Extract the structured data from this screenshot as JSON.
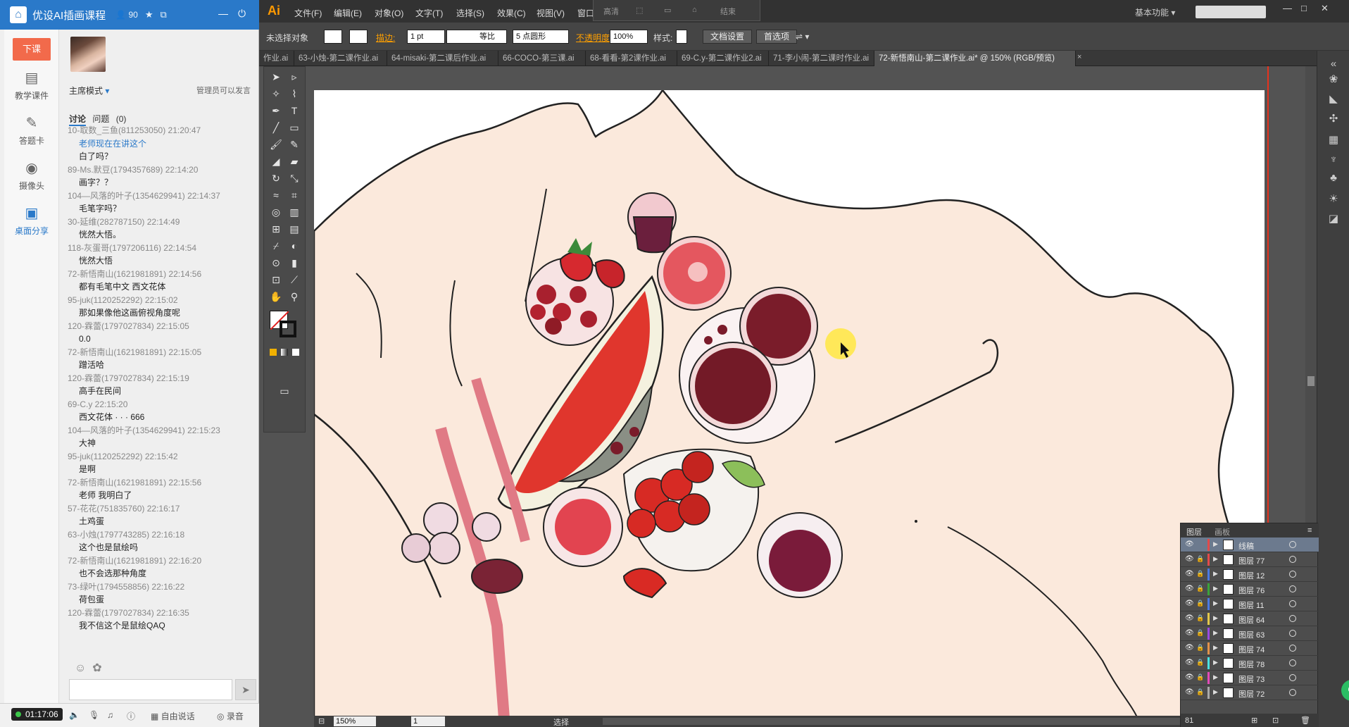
{
  "left_panel": {
    "title": "优设AI插画课程",
    "count": "90",
    "end_class": "下课",
    "nav": [
      "教学课件",
      "答题卡",
      "摄像头",
      "桌面分享"
    ],
    "mode": "主席模式",
    "admin_note": "管理员可以发言",
    "tab_discuss": "讨论",
    "tab_question": "问题",
    "question_count": "(0)",
    "messages": [
      {
        "u": "10-取数_三鱼(811253050) 21:20:47",
        "t": "老师现在在讲这个",
        "link": true
      },
      {
        "u": "",
        "t": "白了吗？"
      },
      {
        "u": "89-Ms.默豆(1794357689) 22:14:20",
        "t": "画字？？"
      },
      {
        "u": "104—风落的叶子(1354629941) 22:14:37",
        "t": "毛笔字吗？"
      },
      {
        "u": "30-延维(282787150) 22:14:49",
        "t": "恍然大悟。"
      },
      {
        "u": "118-灰蛋哥(1797206116) 22:14:54",
        "t": "恍然大悟"
      },
      {
        "u": "72-新悟南山(1621981891) 22:14:56",
        "t": "都有毛笔中文 西文花体"
      },
      {
        "u": "95-juk(1120252292) 22:15:02",
        "t": "那如果像他这画俯视角度呢"
      },
      {
        "u": "120-霖蕾(1797027834) 22:15:05",
        "t": "0.0"
      },
      {
        "u": "72-新悟南山(1621981891) 22:15:05",
        "t": "蹭活哈"
      },
      {
        "u": "120-霖蕾(1797027834) 22:15:19",
        "t": "高手在民间"
      },
      {
        "u": "69-C.y 22:15:20",
        "t": "西文花体 · · · 666"
      },
      {
        "u": "104—风落的叶子(1354629941) 22:15:23",
        "t": "大神"
      },
      {
        "u": "95-juk(1120252292) 22:15:42",
        "t": "是啊"
      },
      {
        "u": "72-新悟南山(1621981891) 22:15:56",
        "t": "老师  我明白了"
      },
      {
        "u": "57-花花(751835760) 22:16:17",
        "t": "土鸡蛋"
      },
      {
        "u": "63-小烛(1797743285) 22:16:18",
        "t": "这个也是鼠绘吗"
      },
      {
        "u": "72-新悟南山(1621981891) 22:16:20",
        "t": "也不会选那种角度"
      },
      {
        "u": "73-绿叶(1794558856) 22:16:22",
        "t": "荷包蛋"
      },
      {
        "u": "120-霖蕾(1797027834) 22:16:35",
        "t": "我不信这个是鼠绘QAQ"
      }
    ],
    "timer": "01:17:06",
    "free_speech": "自由说话",
    "record": "录音"
  },
  "ai": {
    "logo": "Ai",
    "menu": [
      "文件(F)",
      "编辑(E)",
      "对象(O)",
      "文字(T)",
      "选择(S)",
      "效果(C)",
      "视图(V)",
      "窗口"
    ],
    "record_bar": [
      "高清",
      "结束"
    ],
    "workspace": "基本功能",
    "control": {
      "no_selection": "未选择对象",
      "stroke_label": "描边:",
      "stroke_value": "1 pt",
      "profile": "等比",
      "brush": "5 点圆形",
      "opacity_label": "不透明度:",
      "opacity_value": "100%",
      "style_label": "样式:",
      "doc_setup": "文档设置",
      "prefs": "首选项"
    },
    "tabs": [
      "作业.ai",
      "63-小烛-第二课作业.ai",
      "64-misaki-第二课后作业.ai",
      "66-COCO-第三课.ai",
      "68-看看-第2课作业.ai",
      "69-C.y-第二课作业2.ai",
      "71-李小闹-第二课时作业.ai",
      "72-新悟南山-第二课作业.ai* @ 150% (RGB/预览)"
    ],
    "status": {
      "zoom": "150%",
      "page": "1",
      "mode": "选择"
    },
    "layers": {
      "tab_layers": "图层",
      "tab_artboards": "画板",
      "rows": [
        {
          "name": "线稿",
          "color": "#e24a4a"
        },
        {
          "name": "图层 77",
          "color": "#e24a4a"
        },
        {
          "name": "图层 12",
          "color": "#4a7ae2"
        },
        {
          "name": "图层 76",
          "color": "#3aa33a"
        },
        {
          "name": "图层 11",
          "color": "#4a7ae2"
        },
        {
          "name": "图层 64",
          "color": "#e2c84a"
        },
        {
          "name": "图层 63",
          "color": "#9a4ae2"
        },
        {
          "name": "图层 74",
          "color": "#e2924a"
        },
        {
          "name": "图层 78",
          "color": "#4ae2e2"
        },
        {
          "name": "图层 73",
          "color": "#e24ab8"
        },
        {
          "name": "图层 72",
          "color": "#aaaaaa"
        }
      ],
      "count": "81"
    }
  }
}
